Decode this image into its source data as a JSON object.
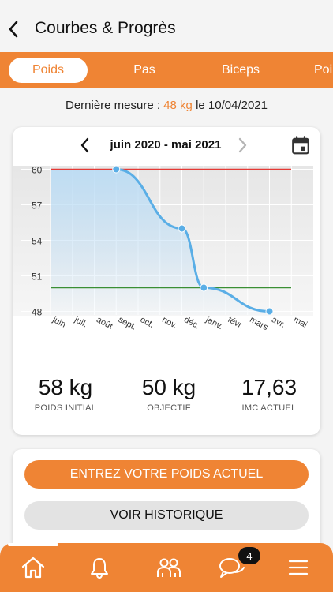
{
  "header": {
    "title": "Courbes & Progrès"
  },
  "tabs": [
    {
      "label": "Poids",
      "active": true
    },
    {
      "label": "Pas",
      "active": false
    },
    {
      "label": "Biceps",
      "active": false
    },
    {
      "label": "Poi",
      "active": false
    }
  ],
  "last_measure": {
    "prefix": "Dernière mesure : ",
    "value": "48 kg",
    "middle": " le ",
    "date": "10/04/2021"
  },
  "period": {
    "label": "juin 2020 - mai 2021"
  },
  "chart_data": {
    "type": "line",
    "x": [
      "juin",
      "juil.",
      "août",
      "sept.",
      "oct.",
      "nov.",
      "déc.",
      "janv.",
      "févr.",
      "mars",
      "avr.",
      "mai"
    ],
    "y_ticks": [
      60,
      57,
      54,
      51,
      48
    ],
    "ylim": [
      47.7,
      60.3
    ],
    "series": [
      {
        "points": [
          {
            "x": "sept.",
            "y": 60
          },
          {
            "x": "déc.",
            "y": 55
          },
          {
            "x": "janv.",
            "y": 50
          },
          {
            "x": "avr.",
            "y": 48
          }
        ]
      }
    ],
    "reference_lines": [
      {
        "y": 60,
        "color": "#e53935"
      },
      {
        "y": 50,
        "color": "#3a8f34"
      }
    ],
    "grid": true,
    "colors": {
      "line": "#5aaee6",
      "fill_top": "#bcdcf4",
      "plot_bg": "#ededed"
    }
  },
  "stats": [
    {
      "value": "58 kg",
      "label": "POIDS INITIAL"
    },
    {
      "value": "50 kg",
      "label": "OBJECTIF"
    },
    {
      "value": "17,63",
      "label": "IMC ACTUEL"
    }
  ],
  "actions": {
    "primary_label": "ENTREZ VOTRE POIDS ACTUEL",
    "secondary_label": "VOIR HISTORIQUE"
  },
  "nav": {
    "items": [
      "home-icon",
      "bell-icon",
      "people-icon",
      "chat-icon",
      "menu-icon"
    ],
    "chat_badge": "4"
  },
  "colors": {
    "accent": "#ef8434"
  }
}
